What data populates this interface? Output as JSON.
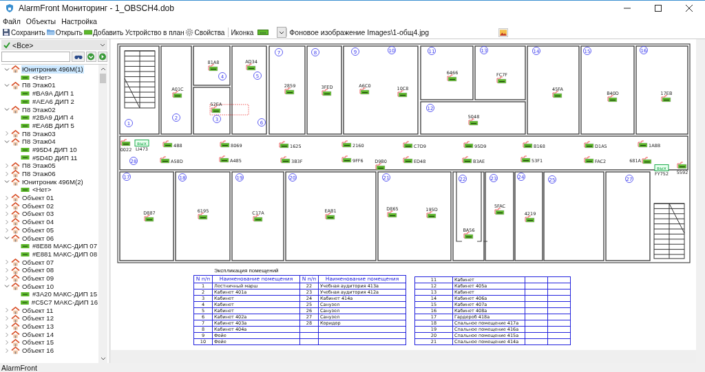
{
  "window": {
    "title": "AlarmFront Мониторинг - 1_OBSCH4.dob"
  },
  "menu": [
    "Файл",
    "Объекты",
    "Настройка"
  ],
  "toolbar": {
    "buttons": [
      {
        "label": "Сохранить",
        "kind": "save"
      },
      {
        "label": "Открыть",
        "kind": "open"
      },
      {
        "label": "Добавить Устройство в план",
        "kind": "add"
      },
      {
        "label": "Свойства",
        "kind": "gear"
      }
    ],
    "icon_label": "Иконка",
    "background_image": "Фоновое изображение Images\\1-общ4.jpg"
  },
  "sidebar": {
    "filter": "<Все>",
    "tree": [
      {
        "label": "Юнитроник 496М(1)",
        "kind": "object",
        "expanded": true,
        "selected": true,
        "children": [
          {
            "label": "<Нет>",
            "kind": "device",
            "selected": false
          }
        ]
      },
      {
        "label": "П8 Этаж01",
        "kind": "object",
        "expanded": true,
        "selected": false,
        "children": [
          {
            "label": "#BA9A ДИП 1",
            "kind": "device",
            "selected": false
          },
          {
            "label": "#AEA6 ДИП 2",
            "kind": "device",
            "selected": false
          }
        ]
      },
      {
        "label": "П8 Этаж02",
        "kind": "object",
        "expanded": true,
        "selected": false,
        "children": [
          {
            "label": "#2BA9 ДИП 4",
            "kind": "device",
            "selected": false
          },
          {
            "label": "#EA6B ДИП 5",
            "kind": "device",
            "selected": false
          }
        ]
      },
      {
        "label": "П8 Этаж03",
        "kind": "object",
        "expanded": false,
        "selected": false
      },
      {
        "label": "П8 Этаж04",
        "kind": "object",
        "expanded": true,
        "selected": false,
        "children": [
          {
            "label": "#95D4 ДИП 10",
            "kind": "device",
            "selected": false
          },
          {
            "label": "#5D4D ДИП 11",
            "kind": "device",
            "selected": false
          }
        ]
      },
      {
        "label": "П8 Этаж05",
        "kind": "object",
        "expanded": false,
        "selected": false
      },
      {
        "label": "П8 Этаж06",
        "kind": "object",
        "expanded": false,
        "selected": false
      },
      {
        "label": "Юнитроник 496М(2)",
        "kind": "object",
        "expanded": true,
        "selected": false,
        "children": [
          {
            "label": "<Нет>",
            "kind": "device",
            "selected": false
          }
        ]
      },
      {
        "label": "Объект 01",
        "kind": "object",
        "expanded": false,
        "selected": false
      },
      {
        "label": "Объект 02",
        "kind": "object",
        "expanded": false,
        "selected": false
      },
      {
        "label": "Объект 03",
        "kind": "object",
        "expanded": false,
        "selected": false
      },
      {
        "label": "Объект 04",
        "kind": "object",
        "expanded": false,
        "selected": false
      },
      {
        "label": "Объект 05",
        "kind": "object",
        "expanded": false,
        "selected": false
      },
      {
        "label": "Объект 06",
        "kind": "object",
        "expanded": true,
        "selected": false,
        "children": [
          {
            "label": "#8E88 МАКС-ДИП 07",
            "kind": "device",
            "selected": false
          },
          {
            "label": "#E881 МАКС-ДИП 08",
            "kind": "device",
            "selected": false
          }
        ]
      },
      {
        "label": "Объект 07",
        "kind": "object",
        "expanded": false,
        "selected": false
      },
      {
        "label": "Объект 08",
        "kind": "object",
        "expanded": false,
        "selected": false
      },
      {
        "label": "Объект 09",
        "kind": "object",
        "expanded": false,
        "selected": false
      },
      {
        "label": "Объект 10",
        "kind": "object",
        "expanded": true,
        "selected": false,
        "children": [
          {
            "label": "#3A20 МАКС-ДИП 15",
            "kind": "device",
            "selected": false
          },
          {
            "label": "#C5C7 МАКС-ДИП 16",
            "kind": "device",
            "selected": false
          }
        ]
      },
      {
        "label": "Объект 11",
        "kind": "object",
        "expanded": false,
        "selected": false
      },
      {
        "label": "Объект 12",
        "kind": "object",
        "expanded": false,
        "selected": false
      },
      {
        "label": "Объект 13",
        "kind": "object",
        "expanded": false,
        "selected": false
      },
      {
        "label": "Объект 14",
        "kind": "object",
        "expanded": false,
        "selected": false
      },
      {
        "label": "Объект 15",
        "kind": "object",
        "expanded": false,
        "selected": false
      },
      {
        "label": "Объект 16",
        "kind": "object",
        "expanded": false,
        "selected": false
      }
    ]
  },
  "plan": {
    "rooms": [
      "1",
      "2",
      "4",
      "5",
      "3",
      "6",
      "7",
      "8",
      "9",
      "10",
      "11",
      "13",
      "14",
      "15",
      "16",
      "12",
      "28",
      "17",
      "18",
      "19",
      "20",
      "21",
      "22",
      "23",
      "24",
      "25",
      "27"
    ],
    "devices": [
      {
        "kind": "sensor",
        "label": "81A8",
        "selected": false
      },
      {
        "kind": "sensor",
        "label": "AD34",
        "selected": false
      },
      {
        "kind": "sensor",
        "label": "A01C",
        "selected": false
      },
      {
        "kind": "sensor",
        "label": "52EA",
        "selected": true
      },
      {
        "kind": "sensor",
        "label": "2859",
        "selected": false
      },
      {
        "kind": "sensor",
        "label": "3FED",
        "selected": false
      },
      {
        "kind": "sensor",
        "label": "A6C0",
        "selected": false
      },
      {
        "kind": "sensor",
        "label": "10C8",
        "selected": false
      },
      {
        "kind": "sensor",
        "label": "6466",
        "selected": false
      },
      {
        "kind": "sensor",
        "label": "FC7F",
        "selected": false
      },
      {
        "kind": "sensor",
        "label": "45FA",
        "selected": false
      },
      {
        "kind": "sensor",
        "label": "B40D",
        "selected": false
      },
      {
        "kind": "sensor",
        "label": "17EB",
        "selected": false
      },
      {
        "kind": "sensor",
        "label": "5048",
        "selected": false
      },
      {
        "kind": "sensor",
        "label": "0022",
        "selected": false
      },
      {
        "kind": "exit",
        "sign": "вых",
        "label": "LI473",
        "selected": false
      },
      {
        "kind": "sensor",
        "label": "4B8",
        "selected": false
      },
      {
        "kind": "sensor",
        "label": "8069",
        "selected": false
      },
      {
        "kind": "sensor",
        "label": "1625",
        "selected": false
      },
      {
        "kind": "sensor",
        "label": "2160",
        "selected": false
      },
      {
        "kind": "sensor",
        "label": "C7D9",
        "selected": false
      },
      {
        "kind": "sensor",
        "label": "95D9",
        "selected": false
      },
      {
        "kind": "sensor",
        "label": "B168",
        "selected": false
      },
      {
        "kind": "sensor",
        "label": "D1A5",
        "selected": false
      },
      {
        "kind": "sensor",
        "label": "1A8B",
        "selected": false
      },
      {
        "kind": "sensor",
        "label": "A58D",
        "selected": false
      },
      {
        "kind": "sensor",
        "label": "A485",
        "selected": false
      },
      {
        "kind": "sensor",
        "label": "3B3F",
        "selected": false
      },
      {
        "kind": "sensor",
        "label": "9FF6",
        "selected": false
      },
      {
        "kind": "sensor",
        "label": "D9B0",
        "selected": false
      },
      {
        "kind": "sensor",
        "label": "ED48",
        "selected": false
      },
      {
        "kind": "sensor",
        "label": "B3AE",
        "selected": false
      },
      {
        "kind": "sensor",
        "label": "53F1",
        "selected": false
      },
      {
        "kind": "sensor",
        "label": "FAC2",
        "selected": false
      },
      {
        "kind": "sensor",
        "label": "681A",
        "selected": false
      },
      {
        "kind": "exit",
        "sign": "вых",
        "label": "FY752",
        "selected": false
      },
      {
        "kind": "sensor",
        "label": "5592",
        "selected": false
      },
      {
        "kind": "sensor",
        "label": "D887",
        "selected": false
      },
      {
        "kind": "sensor",
        "label": "6195",
        "selected": false
      },
      {
        "kind": "sensor",
        "label": "C17A",
        "selected": false
      },
      {
        "kind": "sensor",
        "label": "EAB1",
        "selected": false
      },
      {
        "kind": "sensor",
        "label": "D865",
        "selected": false
      },
      {
        "kind": "sensor",
        "label": "195D",
        "selected": false
      },
      {
        "kind": "sensor",
        "label": "5FAC",
        "selected": false
      },
      {
        "kind": "sensor",
        "label": "4219",
        "selected": false
      },
      {
        "kind": "sensor",
        "label": "BA56",
        "selected": false
      }
    ]
  },
  "explication": {
    "title": "Экспликация помещений",
    "columns": [
      "N п/п",
      "Наименование помещения",
      "N п/п",
      "Наименование помещения"
    ],
    "left_rows": [
      {
        "n": "1",
        "name": "Лестничный марш"
      },
      {
        "n": "2",
        "name": "Кабинет 401а"
      },
      {
        "n": "3",
        "name": "Кабинет"
      },
      {
        "n": "4",
        "name": "Кабинет"
      },
      {
        "n": "5",
        "name": "Кабинет"
      },
      {
        "n": "6",
        "name": "Кабинет 402а"
      },
      {
        "n": "7",
        "name": "Кабинет 403а"
      },
      {
        "n": "8",
        "name": "Кабинет 404а"
      },
      {
        "n": "9",
        "name": "Фойе"
      },
      {
        "n": "10",
        "name": "Фойе"
      }
    ],
    "middle_rows": [
      {
        "n": "22",
        "name": "Учебная аудитория 413а"
      },
      {
        "n": "23",
        "name": "Учебная аудитория 412а"
      },
      {
        "n": "24",
        "name": "Кабинет 414а"
      },
      {
        "n": "25",
        "name": "Санузел"
      },
      {
        "n": "26",
        "name": "Санузел"
      },
      {
        "n": "27",
        "name": "Санузел"
      },
      {
        "n": "28",
        "name": "Коридор"
      }
    ],
    "right_rows": [
      {
        "n": "11",
        "name": "Кабинет"
      },
      {
        "n": "12",
        "name": "Кабинет 405а"
      },
      {
        "n": "13",
        "name": "Кабинет"
      },
      {
        "n": "14",
        "name": "Кабинет 406а"
      },
      {
        "n": "15",
        "name": "Кабинет 407а"
      },
      {
        "n": "16",
        "name": "Кабинет 408а"
      },
      {
        "n": "17",
        "name": "Гардероб 418а"
      },
      {
        "n": "18",
        "name": "Спальное помещение 417а"
      },
      {
        "n": "19",
        "name": "Спальное помещение 416а"
      },
      {
        "n": "20",
        "name": "Спальное помещение 415а"
      },
      {
        "n": "21",
        "name": "Спальное помещение 414а"
      }
    ]
  },
  "status_bar": "AlarmFront"
}
